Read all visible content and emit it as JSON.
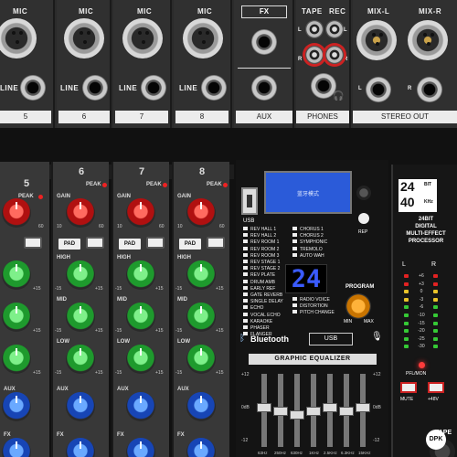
{
  "rear": {
    "mic_label": "MIC",
    "line_label": "LINE",
    "channel_numbers": [
      "5",
      "6",
      "7",
      "8"
    ],
    "fx_label": "FX",
    "aux_label": "AUX",
    "tape_label": "TAPE",
    "rec_label": "REC",
    "l_label": "L",
    "r_label": "R",
    "phones_label": "PHONES",
    "mix_l_label": "MIX-L",
    "mix_r_label": "MIX-R",
    "stereo_out_label": "STEREO OUT"
  },
  "channels": [
    {
      "number": "5"
    },
    {
      "number": "6"
    },
    {
      "number": "7"
    },
    {
      "number": "8"
    }
  ],
  "strip_labels": {
    "gain": "GAIN",
    "peak": "PEAK",
    "pad": "PAD",
    "high": "HIGH",
    "mid": "MID",
    "low": "LOW",
    "aux": "AUX",
    "fx": "FX",
    "gain_min": "10",
    "gain_max": "60",
    "eq_min": "-15",
    "eq_max": "+15"
  },
  "fx_panel": {
    "usb_label": "USB",
    "lcd_text": "蓝牙模式",
    "rep_label": "REP",
    "effects_left": [
      "REV HALL 1",
      "REV HALL 2",
      "REV ROOM 1",
      "REV ROOM 2",
      "REV ROOM 3",
      "REV STAGE 1",
      "REV STAGE 2",
      "REV PLATE",
      "DRUM AMB",
      "EARLY REF",
      "GATE REVERB",
      "SINGLE DELAY",
      "ECHO",
      "VOCAL ECHO",
      "KARAOKE",
      "PHASER",
      "FLANGER"
    ],
    "effects_right": [
      "CHORUS 1",
      "CHORUS 2",
      "SYMPHONIC",
      "TREMOLO",
      "AUTO WAH"
    ],
    "effects_right_lower": [
      "RADIO VOICE",
      "DISTORTION",
      "PITCH CHANGE"
    ],
    "program_display": "24",
    "program_label": "PROGRAM",
    "min_label": "MIN",
    "max_label": "MAX",
    "bluetooth_label": "Bluetooth",
    "usb_interface_label": "USB",
    "geq_title": "GRAPHIC EQUALIZER",
    "geq_scale": [
      "+12",
      "0dB",
      "-12"
    ],
    "geq_bands": [
      "63Hz",
      "250Hz",
      "630Hz",
      "1KHz",
      "2.5KHz",
      "6.3KHz",
      "15KHz"
    ]
  },
  "processor": {
    "badge_top": "24",
    "badge_bottom": "40",
    "badge_side": "BIT",
    "badge_side2": "KHz",
    "desc": [
      "24BIT",
      "DIGITAL",
      "MULTI-EFFECT",
      "PROCESSOR"
    ],
    "l_label": "L",
    "r_label": "R",
    "meter_scale": [
      "+6",
      "+3",
      "0",
      "-3",
      "-6",
      "-10",
      "-15",
      "-20",
      "-25",
      "-30"
    ],
    "pfl_label": "PFL/MON",
    "mute_label": "MUTE",
    "p48_label": "+48V",
    "tape_label": "TAPE"
  },
  "watermark": "DPK",
  "colors": {
    "knob_red": "#d01818",
    "knob_green": "#2fbf3f",
    "knob_blue": "#2060d8",
    "lcd_blue": "#2b5bd9",
    "seven_seg": "#3a5bff",
    "led_red": "#e22222",
    "led_green": "#35c935",
    "led_yellow": "#e8c22a"
  }
}
